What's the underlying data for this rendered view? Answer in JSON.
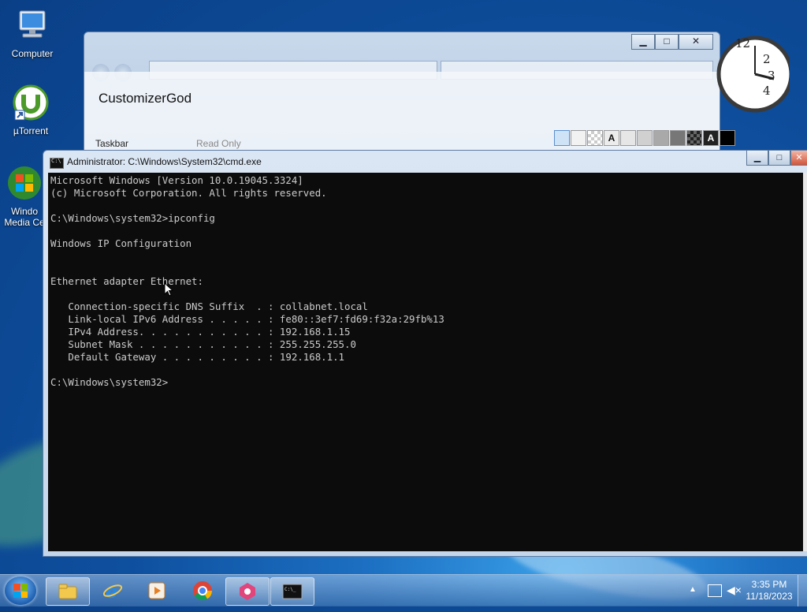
{
  "desktop": {
    "icons": [
      {
        "label": "Computer"
      },
      {
        "label": "µTorrent"
      },
      {
        "label": "Windo\nMedia Ce"
      }
    ]
  },
  "background_window": {
    "title": "CustomizerGod",
    "tab_label": "Taskbar",
    "status_label": "Read Only",
    "swatch_letter": "A"
  },
  "cmd": {
    "title": "Administrator: C:\\Windows\\System32\\cmd.exe",
    "lines": [
      "Microsoft Windows [Version 10.0.19045.3324]",
      "(c) Microsoft Corporation. All rights reserved.",
      "",
      "C:\\Windows\\system32>ipconfig",
      "",
      "Windows IP Configuration",
      "",
      "",
      "Ethernet adapter Ethernet:",
      "",
      "   Connection-specific DNS Suffix  . : collabnet.local",
      "   Link-local IPv6 Address . . . . . : fe80::3ef7:fd69:f32a:29fb%13",
      "   IPv4 Address. . . . . . . . . . . : 192.168.1.15",
      "   Subnet Mask . . . . . . . . . . . : 255.255.255.0",
      "   Default Gateway . . . . . . . . . : 192.168.1.1",
      "",
      "C:\\Windows\\system32>"
    ]
  },
  "clock": {
    "numbers": [
      "12",
      "2",
      "3",
      "4"
    ]
  },
  "taskbar": {
    "apps": [
      {
        "icon": "file-explorer-icon"
      },
      {
        "icon": "internet-explorer-icon"
      },
      {
        "icon": "media-player-icon"
      },
      {
        "icon": "chrome-icon"
      },
      {
        "icon": "customizergod-icon"
      },
      {
        "icon": "cmd-icon"
      }
    ],
    "time": "3:35 PM",
    "date": "11/18/2023"
  }
}
